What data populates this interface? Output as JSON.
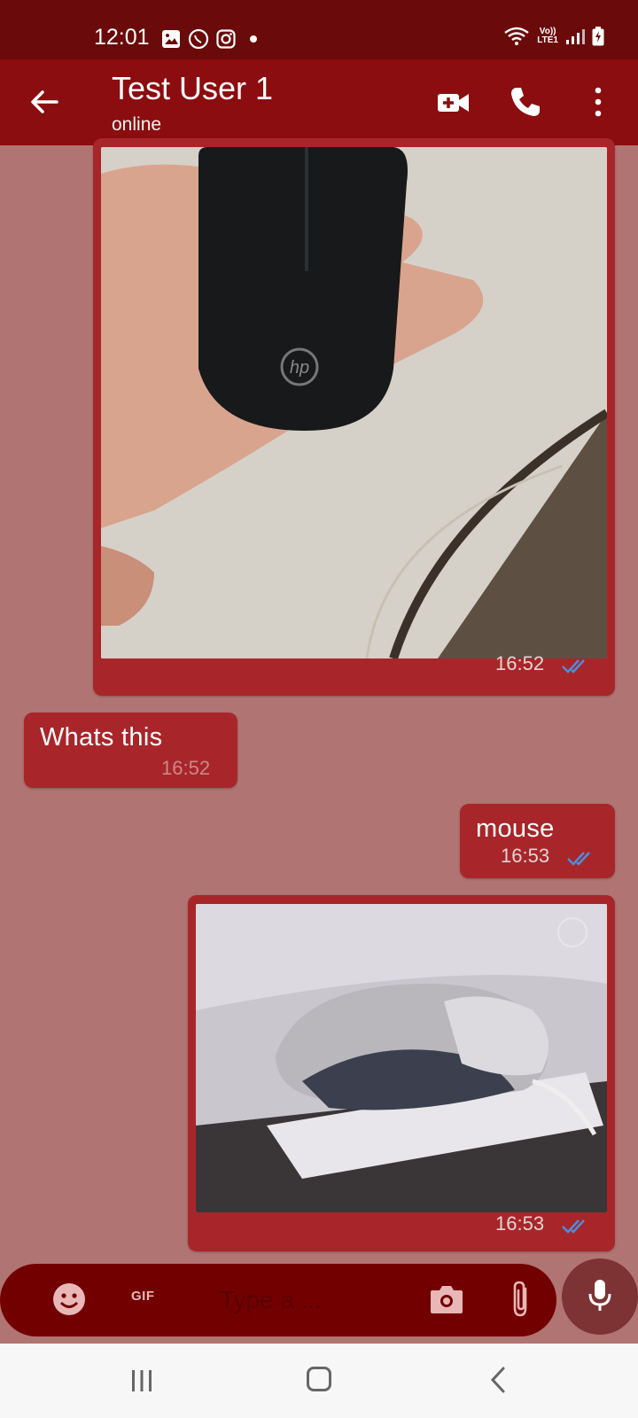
{
  "status_bar": {
    "time": "12:01",
    "network": "LTE1",
    "volte": "Vo))"
  },
  "app_bar": {
    "title": "Test User 1",
    "subtitle": "online",
    "icons": [
      "back-arrow-icon",
      "video-call-icon",
      "phone-icon",
      "more-vert-icon"
    ]
  },
  "messages": [
    {
      "type": "image",
      "direction": "out",
      "time": "16:52",
      "read": true,
      "image_label": "hp",
      "content": "hand holding black HP mouse"
    },
    {
      "type": "text",
      "direction": "in",
      "text": "Whats this",
      "time": "16:52"
    },
    {
      "type": "text",
      "direction": "out",
      "text": "mouse",
      "time": "16:53",
      "read": true
    },
    {
      "type": "image",
      "direction": "out",
      "time": "16:53",
      "read": true,
      "content": "white mouse on paper"
    }
  ],
  "input_bar": {
    "placeholder": "Type a ...",
    "gif_label": "GIF",
    "icons": [
      "emoji-icon",
      "camera-icon",
      "attach-icon",
      "mic-icon"
    ]
  },
  "colors": {
    "status_bar_bg": "#6a0a0a",
    "app_bar_bg": "#8b0d0f",
    "chat_bg": "#b07472",
    "bubble_bg": "#a8262a",
    "input_bg": "#730000",
    "tick_blue": "#4a8fe0"
  }
}
